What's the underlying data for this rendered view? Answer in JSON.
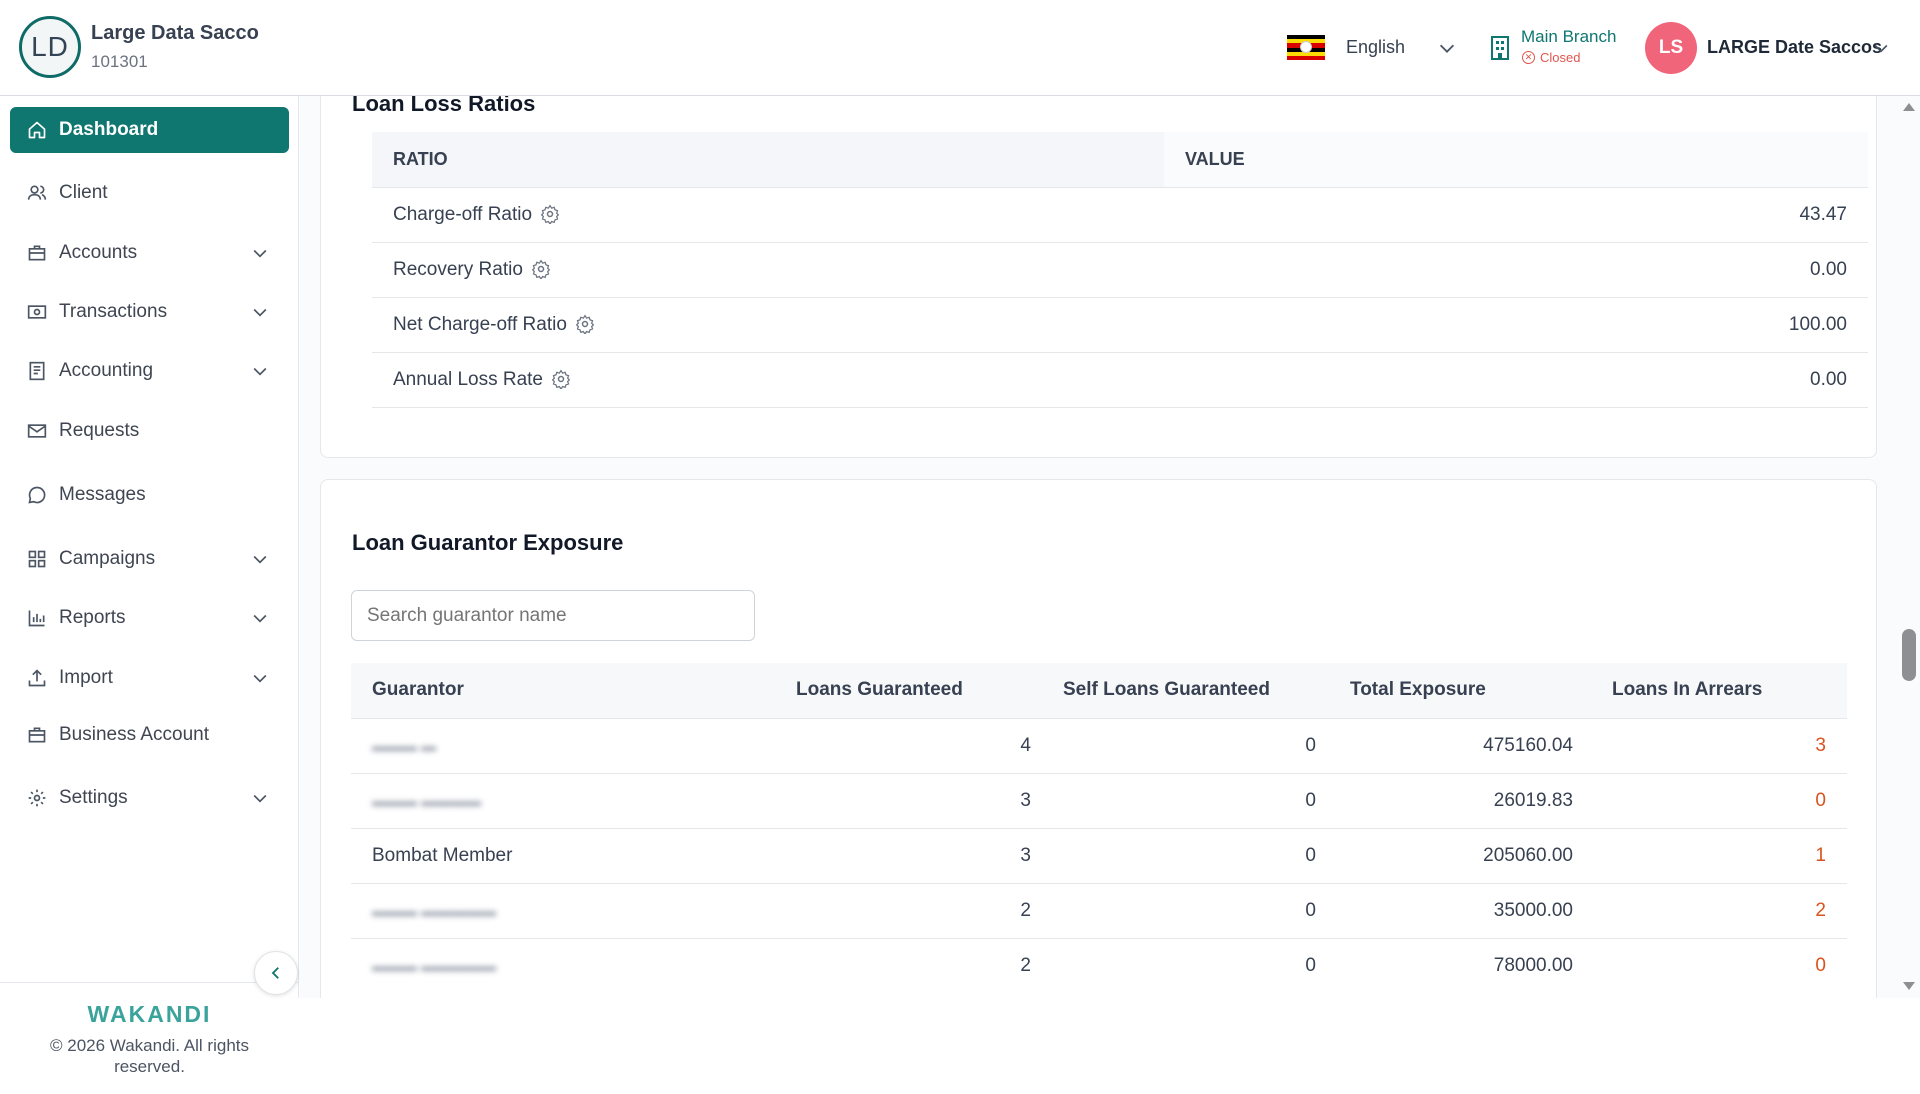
{
  "header": {
    "org_initials": "LD",
    "org_name": "Large Data Sacco",
    "org_code": "101301",
    "language": "English",
    "branch_name": "Main Branch",
    "branch_status": "Closed",
    "user_initials": "LS",
    "user_name": "LARGE Date Saccos"
  },
  "colors": {
    "brand": "#0f7670",
    "arrears": "#d9531e",
    "status_closed": "#e0564f",
    "user_avatar": "#f1657a"
  },
  "sidebar": {
    "items": [
      {
        "label": "Dashboard",
        "icon": "home-icon",
        "active": true,
        "has_children": false
      },
      {
        "label": "Client",
        "icon": "users-icon",
        "active": false,
        "has_children": false
      },
      {
        "label": "Accounts",
        "icon": "briefcase-icon",
        "active": false,
        "has_children": true
      },
      {
        "label": "Transactions",
        "icon": "cash-icon",
        "active": false,
        "has_children": true
      },
      {
        "label": "Accounting",
        "icon": "ledger-icon",
        "active": false,
        "has_children": true
      },
      {
        "label": "Requests",
        "icon": "mail-icon",
        "active": false,
        "has_children": false
      },
      {
        "label": "Messages",
        "icon": "chat-icon",
        "active": false,
        "has_children": false
      },
      {
        "label": "Campaigns",
        "icon": "grid-icon",
        "active": false,
        "has_children": true
      },
      {
        "label": "Reports",
        "icon": "bar-chart-icon",
        "active": false,
        "has_children": true
      },
      {
        "label": "Import",
        "icon": "upload-icon",
        "active": false,
        "has_children": true
      },
      {
        "label": "Business Account",
        "icon": "briefcase-icon",
        "active": false,
        "has_children": false
      },
      {
        "label": "Settings",
        "icon": "gear-icon",
        "active": false,
        "has_children": true
      }
    ],
    "brand": "WAKANDI",
    "copyright": "© 2026 Wakandi. All rights reserved."
  },
  "loss_ratios": {
    "title": "Loan Loss Ratios",
    "columns": [
      "RATIO",
      "VALUE"
    ],
    "rows": [
      {
        "name": "Charge-off Ratio",
        "value": "43.47"
      },
      {
        "name": "Recovery Ratio",
        "value": "0.00"
      },
      {
        "name": "Net Charge-off Ratio",
        "value": "100.00"
      },
      {
        "name": "Annual Loss Rate",
        "value": "0.00"
      }
    ]
  },
  "guarantor": {
    "title": "Loan Guarantor Exposure",
    "search_placeholder": "Search guarantor name",
    "columns": [
      "Guarantor",
      "Loans Guaranteed",
      "Self Loans Guaranteed",
      "Total Exposure",
      "Loans In Arrears"
    ],
    "rows": [
      {
        "name": "",
        "redacted": true,
        "loans": "4",
        "self_loans": "0",
        "exposure": "475160.04",
        "arrears": "3"
      },
      {
        "name": "",
        "redacted": true,
        "loans": "3",
        "self_loans": "0",
        "exposure": "26019.83",
        "arrears": "0"
      },
      {
        "name": "Bombat Member",
        "redacted": false,
        "loans": "3",
        "self_loans": "0",
        "exposure": "205060.00",
        "arrears": "1"
      },
      {
        "name": "",
        "redacted": true,
        "loans": "2",
        "self_loans": "0",
        "exposure": "35000.00",
        "arrears": "2"
      },
      {
        "name": "",
        "redacted": true,
        "loans": "2",
        "self_loans": "0",
        "exposure": "78000.00",
        "arrears": "0"
      }
    ]
  }
}
